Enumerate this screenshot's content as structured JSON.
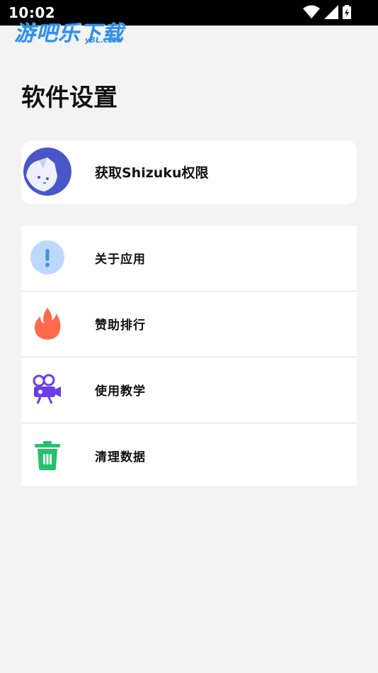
{
  "status_bar": {
    "time": "10:02"
  },
  "watermark": {
    "title": "游吧乐下载",
    "subtitle": "y8L.com"
  },
  "page": {
    "title": "软件设置"
  },
  "shizuku": {
    "label": "获取Shizuku权限",
    "icon": "shizuku-avatar-icon"
  },
  "menu": {
    "items": [
      {
        "label": "关于应用",
        "icon": "info-icon",
        "color": "#3d8ff0"
      },
      {
        "label": "赞助排行",
        "icon": "fire-icon",
        "color": "#ff6a4d"
      },
      {
        "label": "使用教学",
        "icon": "video-camera-icon",
        "color": "#6a3de8"
      },
      {
        "label": "清理数据",
        "icon": "trash-icon",
        "color": "#23c36b"
      }
    ]
  }
}
